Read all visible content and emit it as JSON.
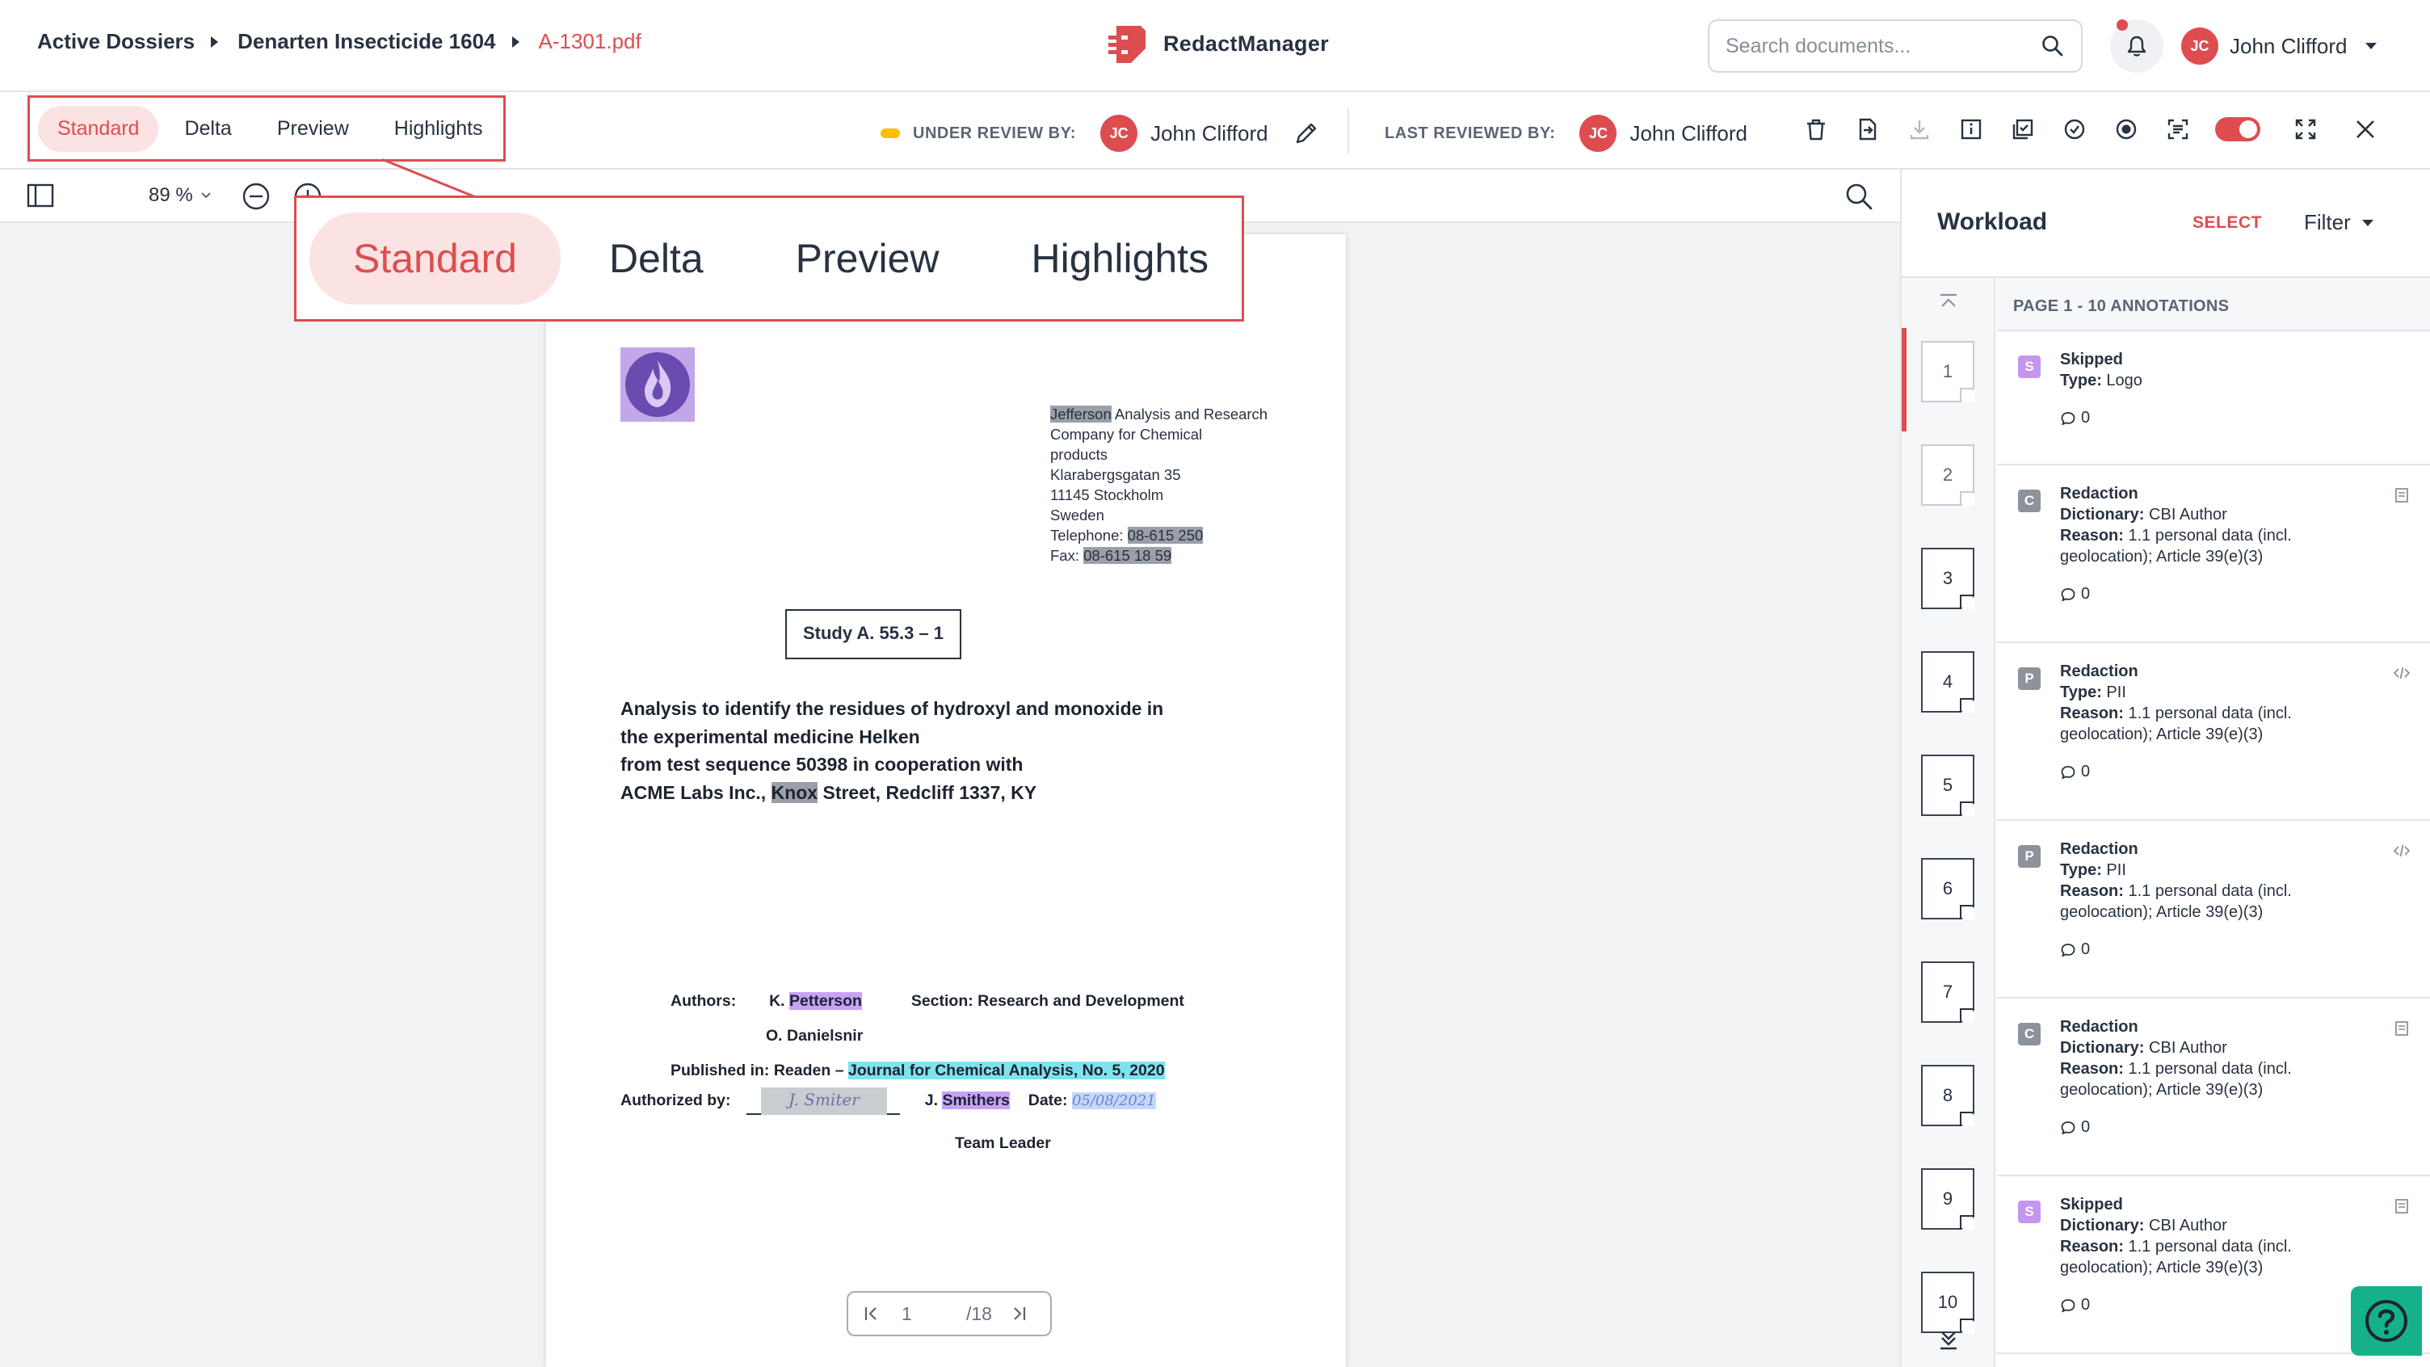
{
  "header": {
    "breadcrumb": [
      "Active Dossiers",
      "Denarten Insecticide 1604",
      "A-1301.pdf"
    ],
    "brand": "RedactManager",
    "search_placeholder": "Search documents...",
    "user": {
      "initials": "JC",
      "name": "John Clifford"
    }
  },
  "viewbar": {
    "modes": [
      "Standard",
      "Delta",
      "Preview",
      "Highlights"
    ],
    "active_mode": "Standard",
    "under_review_label": "UNDER REVIEW BY:",
    "under_review_user": {
      "initials": "JC",
      "name": "John Clifford"
    },
    "last_reviewed_label": "LAST REVIEWED BY:",
    "last_reviewed_user": {
      "initials": "JC",
      "name": "John Clifford"
    }
  },
  "viewer": {
    "zoom": "89 %",
    "pager": {
      "current": "1",
      "total": "/18"
    }
  },
  "document": {
    "address": {
      "line1_hl": "Jefferson",
      "line1_rest": " Analysis and Research",
      "line2": "Company for Chemical",
      "line3": "products",
      "line4": "Klarabergsgatan 35",
      "line5": "11145 Stockholm",
      "line6": "Sweden",
      "tel_label": "Telephone: ",
      "tel": "08-615 250",
      "fax_label": "Fax: ",
      "fax": "08-615 18 59"
    },
    "study": "Study A. 55.3 – 1",
    "title_l1": "Analysis to identify the residues of hydroxyl and monoxide in",
    "title_l2": "the experimental medicine Helken",
    "title_l3": "from test sequence 50398 in cooperation with",
    "title_l4a": "ACME Labs Inc., ",
    "title_l4_hl": "Knox",
    "title_l4b": " Street, Redcliff 1337, KY",
    "authors_label": "Authors:",
    "author1_prefix": "K. ",
    "author1_hl": "Petterson",
    "section": "Section: Research and Development",
    "author2": "O. Danielsnir",
    "published_label": "Published in: Readen – ",
    "published_hl": "Journal for Chemical Analysis, No. 5, 2020",
    "authorized_label": "Authorized by:",
    "signature": "J. Smiter",
    "signer_prefix": "J. ",
    "signer_hl": "Smithers",
    "date_label": "Date:",
    "date_value": "05/08/2021",
    "team_leader": "Team Leader"
  },
  "workload": {
    "title": "Workload",
    "select": "SELECT",
    "filter": "Filter",
    "page_header": "PAGE 1 - 10 ANNOTATIONS",
    "pages": [
      "1",
      "2",
      "3",
      "4",
      "5",
      "6",
      "7",
      "8",
      "9",
      "10"
    ],
    "annotations": [
      {
        "badge": "S",
        "title": "Skipped",
        "k1": "Type:",
        "v1": "Logo",
        "k2": "",
        "v2": "",
        "comments": "0"
      },
      {
        "badge": "C",
        "title": "Redaction",
        "k1": "Dictionary:",
        "v1": "CBI Author",
        "k2": "Reason:",
        "v2": "1.1 personal data (incl. geolocation); Article 39(e)(3)",
        "comments": "0"
      },
      {
        "badge": "P",
        "title": "Redaction",
        "k1": "Type:",
        "v1": "PII",
        "k2": "Reason:",
        "v2": "1.1 personal data (incl. geolocation); Article 39(e)(3)",
        "comments": "0"
      },
      {
        "badge": "P",
        "title": "Redaction",
        "k1": "Type:",
        "v1": "PII",
        "k2": "Reason:",
        "v2": "1.1 personal data (incl. geolocation); Article 39(e)(3)",
        "comments": "0"
      },
      {
        "badge": "C",
        "title": "Redaction",
        "k1": "Dictionary:",
        "v1": "CBI Author",
        "k2": "Reason:",
        "v2": "1.1 personal data (incl. geolocation); Article 39(e)(3)",
        "comments": "0"
      },
      {
        "badge": "S",
        "title": "Skipped",
        "k1": "Dictionary:",
        "v1": "CBI Author",
        "k2": "Reason:",
        "v2": "1.1 personal data (incl. geolocation); Article 39(e)(3)",
        "comments": "0"
      }
    ]
  },
  "colors": {
    "accent": "#dd4d50",
    "help": "#15b18b",
    "status": "#fdbd00"
  }
}
